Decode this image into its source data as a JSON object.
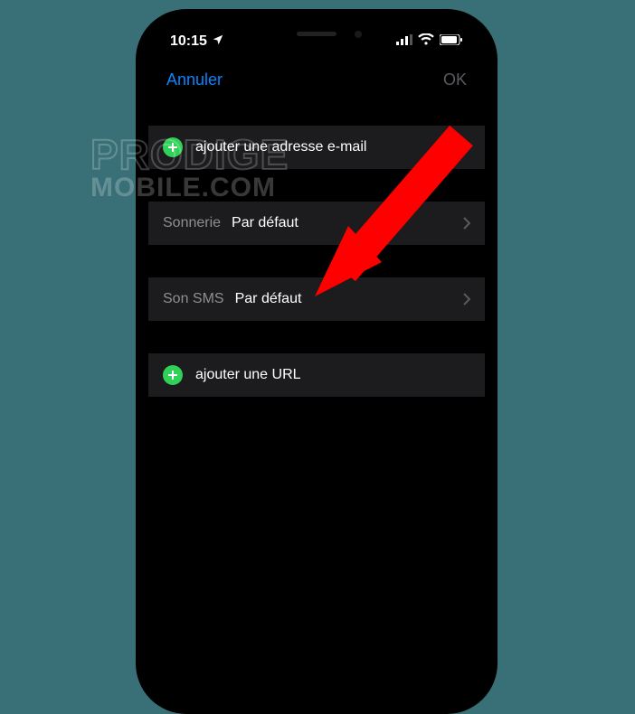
{
  "statusBar": {
    "time": "10:15"
  },
  "nav": {
    "cancel": "Annuler",
    "ok": "OK"
  },
  "rows": {
    "addEmail": "ajouter une adresse e-mail",
    "ringtone": {
      "label": "Sonnerie",
      "value": "Par défaut"
    },
    "textTone": {
      "label": "Son SMS",
      "value": "Par défaut"
    },
    "addUrl": "ajouter une URL"
  },
  "watermark": {
    "line1": "PRODIGE",
    "line2": "MOBILE.COM"
  }
}
